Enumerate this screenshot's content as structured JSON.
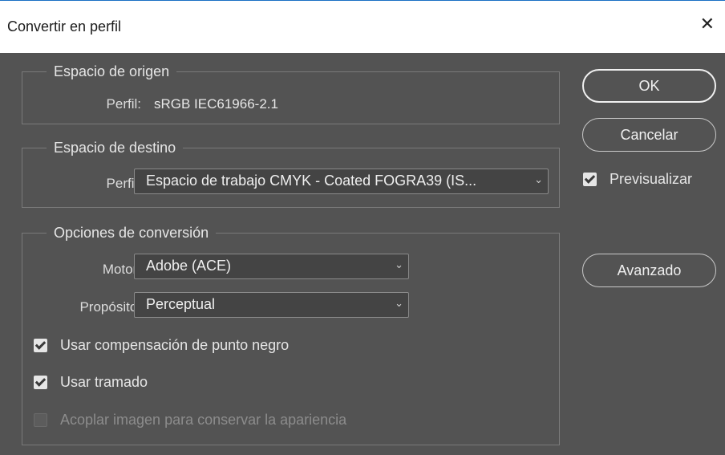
{
  "window": {
    "title": "Convertir en perfil",
    "close_glyph": "✕"
  },
  "origin": {
    "legend": "Espacio de origen",
    "profile_label": "Perfil:",
    "profile_value": "sRGB IEC61966-2.1"
  },
  "destination": {
    "legend": "Espacio de destino",
    "profile_label": "Perfil:",
    "profile_value": "Espacio de trabajo CMYK - Coated FOGRA39 (IS..."
  },
  "conversion": {
    "legend": "Opciones de conversión",
    "engine_label": "Motor:",
    "engine_value": "Adobe (ACE)",
    "intent_label": "Propósito:",
    "intent_value": "Perceptual",
    "black_point": {
      "label": "Usar compensación de punto negro",
      "checked": true
    },
    "dither": {
      "label": "Usar tramado",
      "checked": true
    },
    "flatten": {
      "label": "Acoplar imagen para conservar la apariencia",
      "checked": false,
      "enabled": false
    }
  },
  "buttons": {
    "ok": "OK",
    "cancel": "Cancelar",
    "advanced": "Avanzado"
  },
  "preview": {
    "label": "Previsualizar",
    "checked": true
  },
  "icons": {
    "check": "check-icon",
    "chevron": "chevron-down-icon",
    "close": "close-icon"
  },
  "colors": {
    "background": "#535353",
    "titlebar": "#ffffff",
    "accent_border": "#1a6fc4"
  }
}
